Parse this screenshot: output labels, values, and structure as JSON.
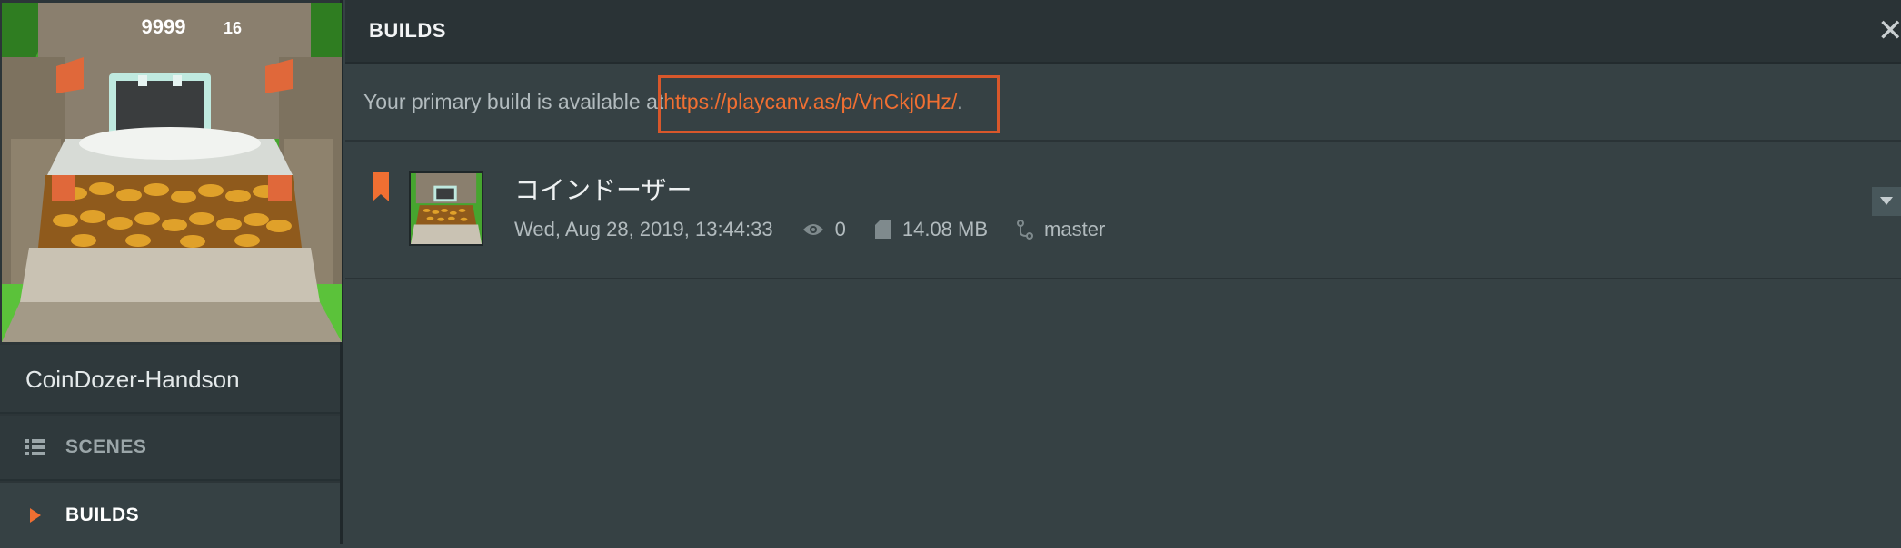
{
  "sidebar": {
    "project_name": "CoinDozer-Handson",
    "thumbnail": {
      "score": "9999",
      "level": "16"
    },
    "items": [
      {
        "label": "SCENES",
        "icon": "list-icon",
        "active": false
      },
      {
        "label": "BUILDS",
        "icon": "caret-right-icon",
        "active": true
      }
    ]
  },
  "header": {
    "title": "BUILDS",
    "close_icon": "close-icon"
  },
  "notice": {
    "prefix": "Your primary build is available at ",
    "url": "https://playcanv.as/p/VnCkj0Hz/",
    "suffix": "."
  },
  "builds": [
    {
      "name": "コインドーザー",
      "date": "Wed, Aug 28, 2019, 13:44:33",
      "views": "0",
      "size": "14.08 MB",
      "branch": "master",
      "primary": true
    }
  ],
  "colors": {
    "accent": "#f06f32",
    "highlight_box": "#d8572b",
    "background": "#364144",
    "sidebar": "#2c3538"
  }
}
